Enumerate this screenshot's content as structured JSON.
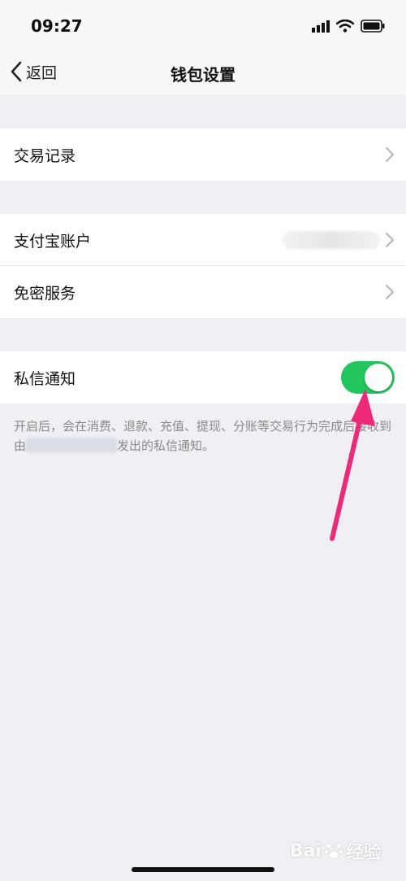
{
  "status_bar": {
    "time": "09:27"
  },
  "nav": {
    "back_label": "返回",
    "title": "钱包设置"
  },
  "rows": {
    "transaction_records": "交易记录",
    "alipay_account": "支付宝账户",
    "password_free": "免密服务",
    "private_message": "私信通知"
  },
  "toggle": {
    "private_message_on": true
  },
  "hint": {
    "line_part1": "开启后，会在消费、退款、充值、提现、分账等交易行为完成后接收到由",
    "line_part2": "发出的私信通知。"
  },
  "watermark": {
    "text": "Bai",
    "suffix": "经验"
  },
  "colors": {
    "toggle_on": "#22c55e",
    "annotation_arrow": "#ec2a78",
    "background": "#efeff4"
  }
}
